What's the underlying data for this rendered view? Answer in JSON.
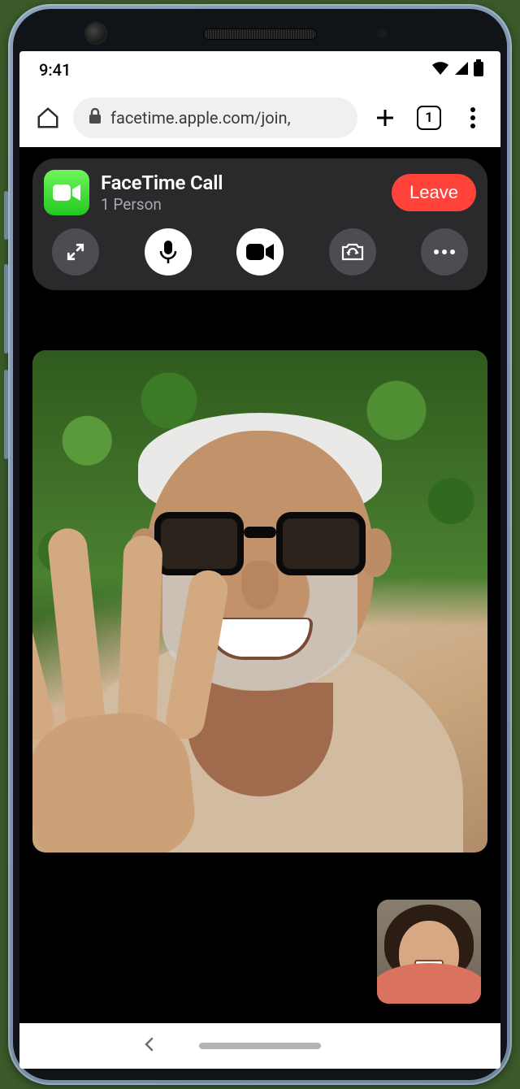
{
  "status": {
    "time": "9:41"
  },
  "browser": {
    "url": "facetime.apple.com/join,",
    "tab_count": "1"
  },
  "call": {
    "title": "FaceTime Call",
    "subtitle": "1 Person",
    "leave_label": "Leave"
  },
  "controls": {
    "expand": "expand-icon",
    "mic": "microphone-icon",
    "camera": "video-icon",
    "flip": "flip-camera-icon",
    "more": "more-icon"
  }
}
